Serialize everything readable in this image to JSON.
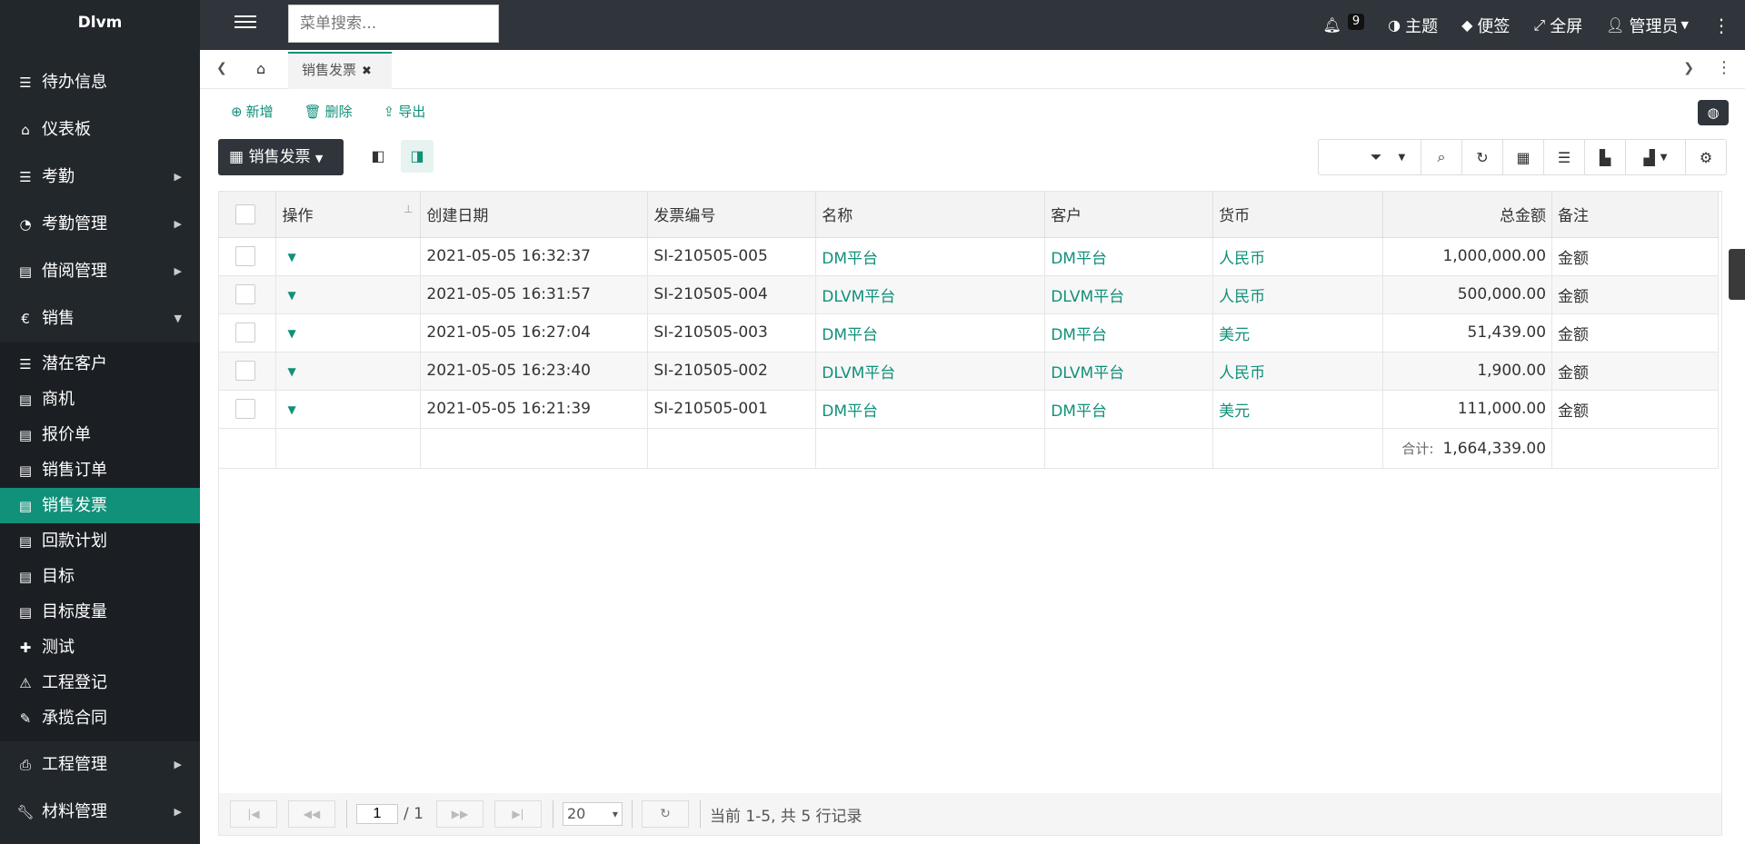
{
  "app": {
    "brand": "Dlvm"
  },
  "sidebar": {
    "items": [
      {
        "label": "待办信息",
        "icon": "list-icon"
      },
      {
        "label": "仪表板",
        "icon": "home-icon"
      },
      {
        "label": "考勤",
        "icon": "list-icon"
      },
      {
        "label": "考勤管理",
        "icon": "dashboard-icon"
      },
      {
        "label": "借阅管理",
        "icon": "file-icon"
      },
      {
        "label": "销售",
        "icon": "euro-icon"
      }
    ],
    "sales_sub": [
      {
        "label": "潜在客户"
      },
      {
        "label": "商机"
      },
      {
        "label": "报价单"
      },
      {
        "label": "销售订单"
      },
      {
        "label": "销售发票"
      },
      {
        "label": "回款计划"
      },
      {
        "label": "目标"
      },
      {
        "label": "目标度量"
      },
      {
        "label": "测试"
      },
      {
        "label": "工程登记"
      },
      {
        "label": "承揽合同"
      }
    ],
    "bottom": [
      {
        "label": "工程管理"
      },
      {
        "label": "材料管理"
      }
    ]
  },
  "topbar": {
    "search_placeholder": "菜单搜索...",
    "notifications": "9",
    "theme": "主题",
    "notes": "便签",
    "fullscreen": "全屏",
    "admin": "管理员"
  },
  "tabs": {
    "active": "销售发票"
  },
  "toolbar": {
    "add": "新增",
    "delete": "删除",
    "export": "导出"
  },
  "view": {
    "label": "销售发票"
  },
  "table": {
    "headers": [
      "操作",
      "创建日期",
      "发票编号",
      "名称",
      "客户",
      "货币",
      "总金额",
      "备注"
    ],
    "rows": [
      {
        "date": "2021-05-05 16:32:37",
        "no": "SI-210505-005",
        "name": "DM平台",
        "customer": "DM平台",
        "currency": "人民币",
        "amount": "1,000,000.00",
        "note": "金额"
      },
      {
        "date": "2021-05-05 16:31:57",
        "no": "SI-210505-004",
        "name": "DLVM平台",
        "customer": "DLVM平台",
        "currency": "人民币",
        "amount": "500,000.00",
        "note": "金额"
      },
      {
        "date": "2021-05-05 16:27:04",
        "no": "SI-210505-003",
        "name": "DM平台",
        "customer": "DM平台",
        "currency": "美元",
        "amount": "51,439.00",
        "note": "金额"
      },
      {
        "date": "2021-05-05 16:23:40",
        "no": "SI-210505-002",
        "name": "DLVM平台",
        "customer": "DLVM平台",
        "currency": "人民币",
        "amount": "1,900.00",
        "note": "金额"
      },
      {
        "date": "2021-05-05 16:21:39",
        "no": "SI-210505-001",
        "name": "DM平台",
        "customer": "DM平台",
        "currency": "美元",
        "amount": "111,000.00",
        "note": "金额"
      }
    ],
    "sum_label": "合计:",
    "sum_value": "1,664,339.00"
  },
  "pager": {
    "page": "1",
    "total_pages": "/ 1",
    "page_size": "20",
    "info": "当前 1-5, 共 5 行记录"
  }
}
